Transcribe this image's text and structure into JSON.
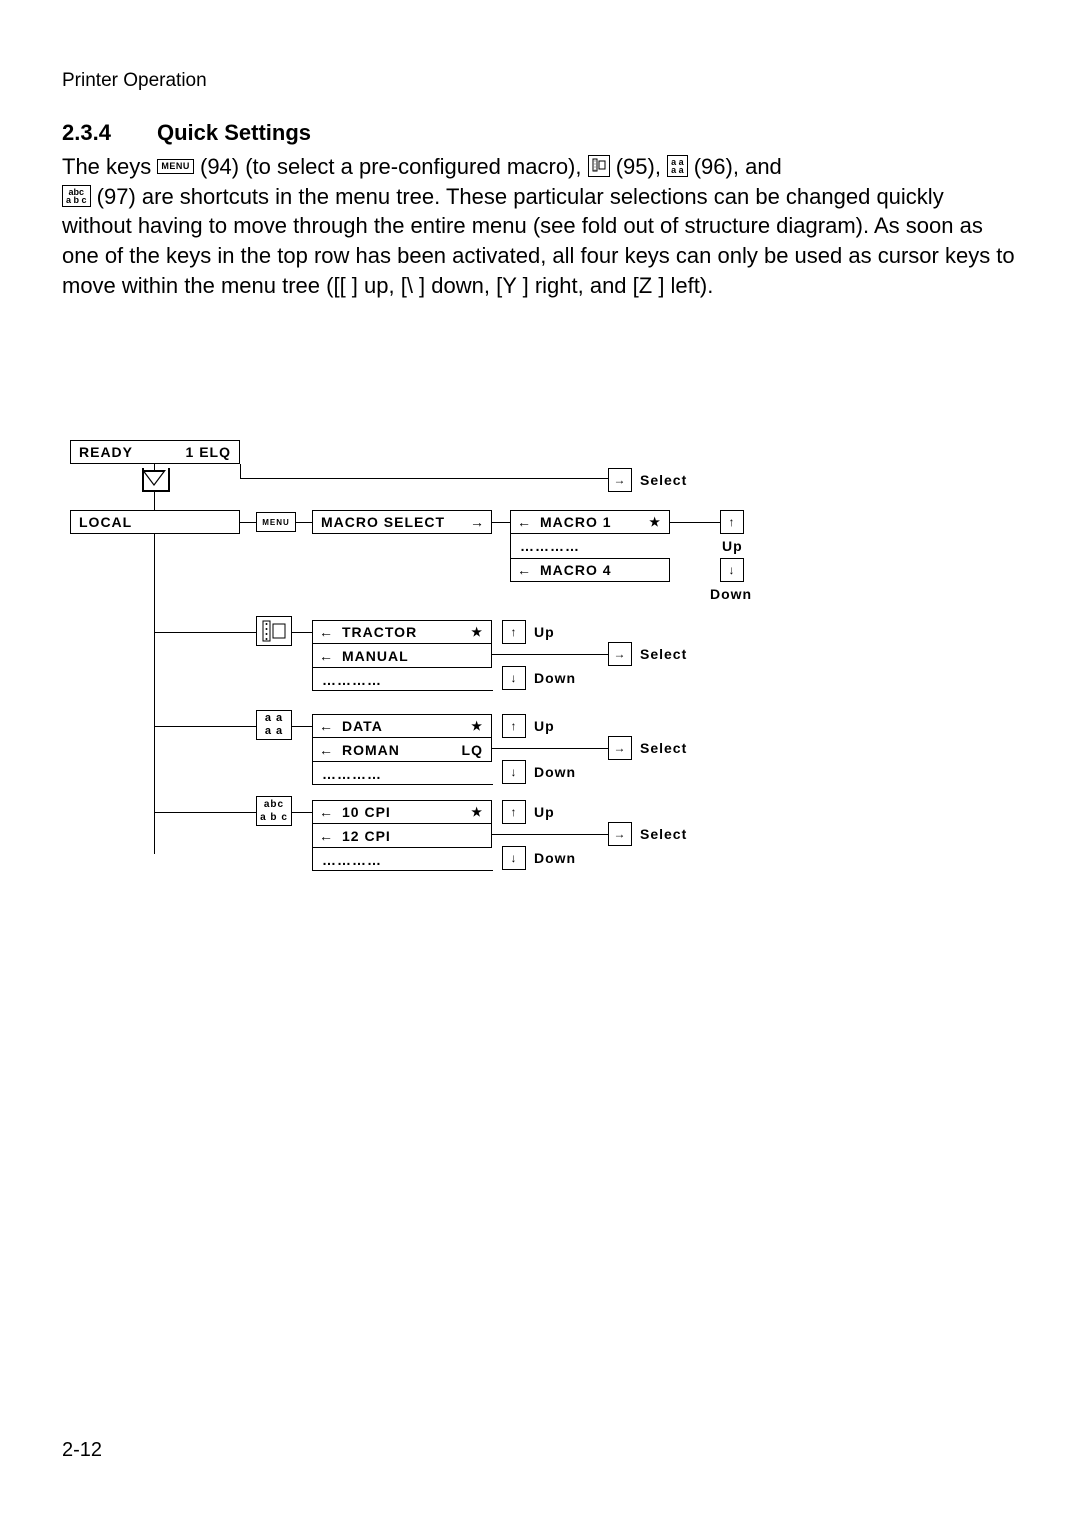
{
  "running_header": "Printer Operation",
  "section_number": "2.3.4",
  "section_title": "Quick Settings",
  "body": {
    "t1": "The keys ",
    "k94": " (94) (to select a pre-configured macro), ",
    "k95": " (95), ",
    "k96": " (96), and ",
    "k97": " (97) are shortcuts in the menu tree. These particular selections can be changed quickly without having to move through the entire menu (see fold out of structure diagram). As soon as one of the keys in the top row has been activated, all four keys can only be used as cursor keys to move within the menu tree ([[ ] up, [\\ ] down, [Y ] right, and [Z ] left)."
  },
  "icons": {
    "menu": "MENU",
    "aa_top": "a a",
    "aa_bot": "a a",
    "abc_top": "abc",
    "abc_bot": "a b c"
  },
  "diagram": {
    "ready": "READY",
    "elq": "1 ELQ",
    "local": "LOCAL",
    "menu": "MENU",
    "macro_select": "MACRO  SELECT",
    "macro1": "MACRO  1",
    "macro4": "MACRO  4",
    "tractor": "TRACTOR",
    "manual": "MANUAL",
    "data": "DATA",
    "roman": "ROMAN",
    "lq": "LQ",
    "cpi10": "10 CPI",
    "cpi12": "12 CPI",
    "select": "Select",
    "up": "Up",
    "down": "Down",
    "arrow_right": "→",
    "arrow_left": "←",
    "arrow_up": "↑",
    "arrow_down": "↓",
    "star": "★",
    "ellipsis": "…………"
  },
  "page_number": "2-12"
}
